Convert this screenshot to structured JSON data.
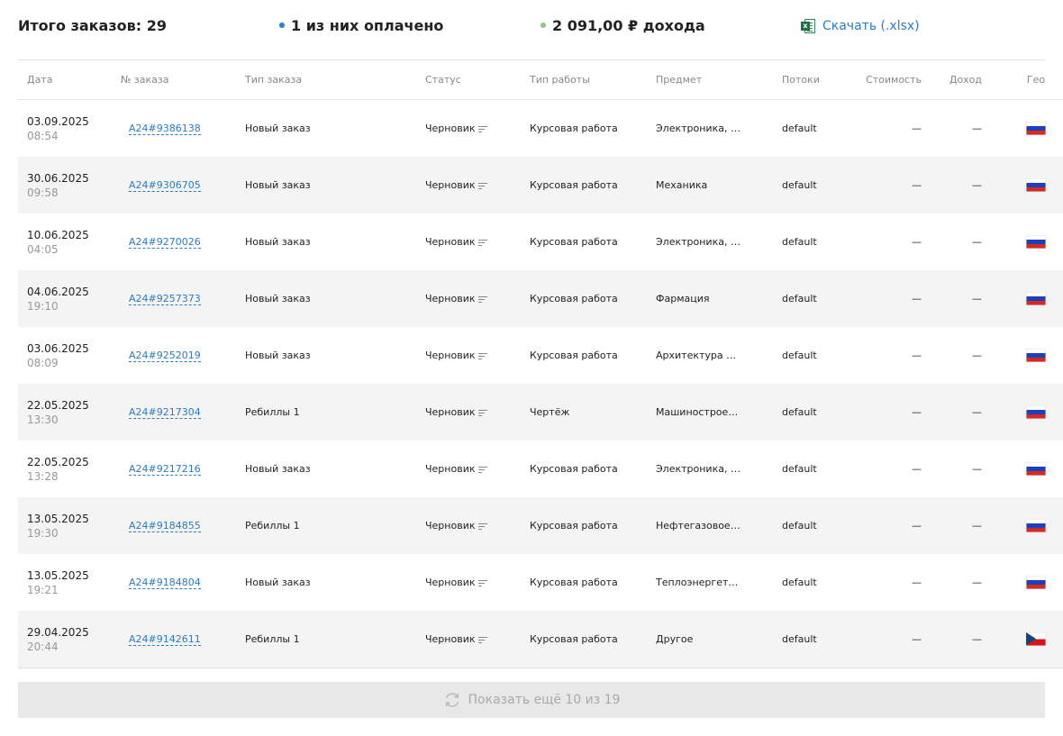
{
  "summary": {
    "total_orders": "Итого заказов: 29",
    "paid": "1 из них оплачено",
    "paid_dot_color": "#2a7bc9",
    "income": "2 091,00 ₽ дохода",
    "income_dot_color": "#8cc97a",
    "download_label": "Скачать (.xlsx)",
    "download_icon": "excel-icon"
  },
  "table": {
    "headers": {
      "date": "Дата",
      "number": "№ заказа",
      "type": "Тип заказа",
      "status": "Статус",
      "work_type": "Тип работы",
      "subject": "Предмет",
      "flows": "Потоки",
      "cost": "Стоимость",
      "income": "Доход",
      "geo": "Гео"
    },
    "rows": [
      {
        "date": "03.09.2025",
        "time": "08:54",
        "number": "A24#9386138",
        "type": "Новый заказ",
        "status": "Черновик",
        "work_type": "Курсовая работа",
        "subject": "Электроника, э…",
        "flows": "default",
        "cost": "—",
        "income": "—",
        "geo": "ru"
      },
      {
        "date": "30.06.2025",
        "time": "09:58",
        "number": "A24#9306705",
        "type": "Новый заказ",
        "status": "Черновик",
        "work_type": "Курсовая работа",
        "subject": "Механика",
        "flows": "default",
        "cost": "—",
        "income": "—",
        "geo": "ru"
      },
      {
        "date": "10.06.2025",
        "time": "04:05",
        "number": "A24#9270026",
        "type": "Новый заказ",
        "status": "Черновик",
        "work_type": "Курсовая работа",
        "subject": "Электроника, э…",
        "flows": "default",
        "cost": "—",
        "income": "—",
        "geo": "ru"
      },
      {
        "date": "04.06.2025",
        "time": "19:10",
        "number": "A24#9257373",
        "type": "Новый заказ",
        "status": "Черновик",
        "work_type": "Курсовая работа",
        "subject": "Фармация",
        "flows": "default",
        "cost": "—",
        "income": "—",
        "geo": "ru"
      },
      {
        "date": "03.06.2025",
        "time": "08:09",
        "number": "A24#9252019",
        "type": "Новый заказ",
        "status": "Черновик",
        "work_type": "Курсовая работа",
        "subject": "Архитектура и …",
        "flows": "default",
        "cost": "—",
        "income": "—",
        "geo": "ru"
      },
      {
        "date": "22.05.2025",
        "time": "13:30",
        "number": "A24#9217304",
        "type": "Ребиллы 1",
        "status": "Черновик",
        "work_type": "Чертёж",
        "subject": "Машинострое…",
        "flows": "default",
        "cost": "—",
        "income": "—",
        "geo": "ru"
      },
      {
        "date": "22.05.2025",
        "time": "13:28",
        "number": "A24#9217216",
        "type": "Новый заказ",
        "status": "Черновик",
        "work_type": "Курсовая работа",
        "subject": "Электроника, э…",
        "flows": "default",
        "cost": "—",
        "income": "—",
        "geo": "ru"
      },
      {
        "date": "13.05.2025",
        "time": "19:30",
        "number": "A24#9184855",
        "type": "Ребиллы 1",
        "status": "Черновик",
        "work_type": "Курсовая работа",
        "subject": "Нефтегазовое …",
        "flows": "default",
        "cost": "—",
        "income": "—",
        "geo": "ru"
      },
      {
        "date": "13.05.2025",
        "time": "19:21",
        "number": "A24#9184804",
        "type": "Новый заказ",
        "status": "Черновик",
        "work_type": "Курсовая работа",
        "subject": "Теплоэнергети…",
        "flows": "default",
        "cost": "—",
        "income": "—",
        "geo": "ru"
      },
      {
        "date": "29.04.2025",
        "time": "20:44",
        "number": "A24#9142611",
        "type": "Ребиллы 1",
        "status": "Черновик",
        "work_type": "Курсовая работа",
        "subject": "Другое",
        "flows": "default",
        "cost": "—",
        "income": "—",
        "geo": "cz"
      }
    ]
  },
  "load_more": {
    "label": "Показать ещё 10 из 19",
    "icon": "refresh-icon"
  }
}
